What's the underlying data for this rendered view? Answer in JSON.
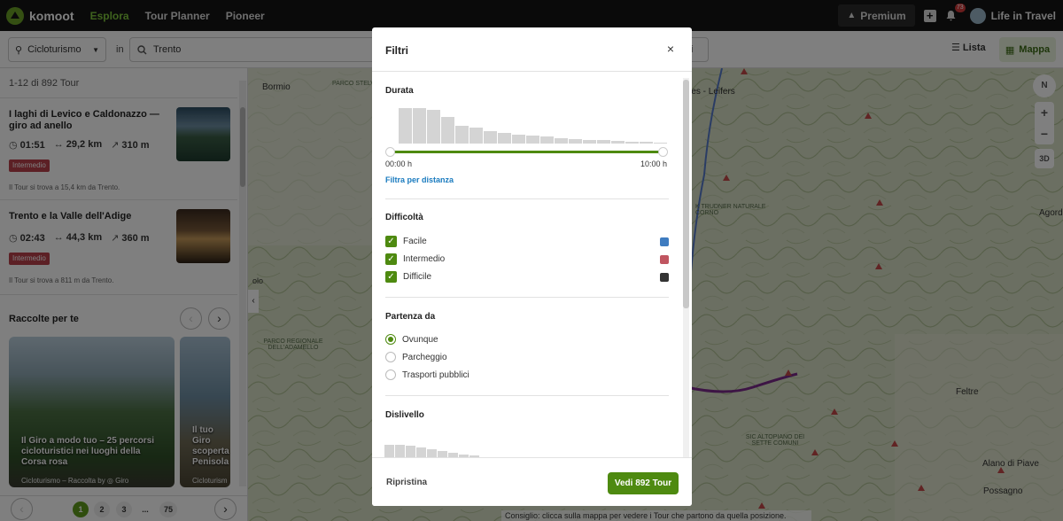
{
  "topbar": {
    "logo": "komoot",
    "nav": [
      "Esplora",
      "Tour Planner",
      "Pioneer"
    ],
    "premium": "Premium",
    "notifications": "73",
    "user": "Life in Travel"
  },
  "filterbar": {
    "sport": "Cicloturismo",
    "in_label": "in",
    "location": "Trento",
    "partial_button": "ri",
    "lista": "Lista",
    "mappa": "Mappa"
  },
  "sidebar": {
    "count": "1-12 di 892 Tour",
    "tours": [
      {
        "title": "I laghi di Levico e Caldonazzo — giro ad anello",
        "duration": "01:51",
        "distance": "29,2 km",
        "elevation": "310 m",
        "difficulty": "Intermedio",
        "note": "Il Tour si trova a 15,4 km da Trento."
      },
      {
        "title": "Trento e la Valle dell'Adige",
        "duration": "02:43",
        "distance": "44,3 km",
        "elevation": "360 m",
        "difficulty": "Intermedio",
        "note": "Il Tour si trova a 811 m da Trento."
      }
    ],
    "collections_title": "Raccolte per te",
    "collections": [
      {
        "title": "Il Giro a modo tuo – 25 percorsi cicloturistici nei luoghi della Corsa rosa",
        "footer": "Cicloturismo – Raccolta by ◎ Giro"
      },
      {
        "title": "Il tuo Giro scoperta Penisola",
        "footer": "Cicloturism"
      }
    ],
    "pages": [
      "1",
      "2",
      "3",
      "...",
      "75"
    ]
  },
  "map": {
    "hint": "Consiglio: clicca sulla mappa per vedere i Tour che partono da quella posizione.",
    "labels": [
      "Bormio",
      "PARCO REGIONALE DELL'ADAMELLO",
      "SIC ALTOPIANO DEI SETTE COMUNI",
      "Laives - Leifers",
      "Feltre",
      "Alano di Piave",
      "Possagno",
      "Agord",
      "olo",
      "PARCO STELVIO",
      "K TRUDNER NATURALE CORNO"
    ],
    "compass": "N",
    "zoom_in": "+",
    "zoom_out": "−",
    "mode_3d": "3D"
  },
  "modal": {
    "title": "Filtri",
    "close": "×",
    "duration": {
      "title": "Durata",
      "min_label": "00:00 h",
      "max_label": "10:00 h",
      "link": "Filtra per distanza",
      "histogram": [
        40,
        40,
        38,
        30,
        20,
        18,
        14,
        12,
        10,
        9,
        8,
        6,
        5,
        4,
        4,
        3,
        2,
        2,
        1
      ]
    },
    "difficulty": {
      "title": "Difficoltà",
      "options": [
        {
          "label": "Facile",
          "checked": true,
          "color": "#3f7cc0"
        },
        {
          "label": "Intermedio",
          "checked": true,
          "color": "#c05560"
        },
        {
          "label": "Difficile",
          "checked": true,
          "color": "#333333"
        }
      ]
    },
    "start": {
      "title": "Partenza da",
      "options": [
        {
          "label": "Ovunque",
          "selected": true
        },
        {
          "label": "Parcheggio",
          "selected": false
        },
        {
          "label": "Trasporti pubblici",
          "selected": false
        }
      ]
    },
    "elevation": {
      "title": "Dislivello",
      "histogram": [
        14,
        14,
        13,
        11,
        9,
        7,
        5,
        3,
        2
      ]
    },
    "reset": "Ripristina",
    "apply": "Vedi 892 Tour"
  },
  "colors": {
    "accent": "#4e8a10",
    "brand": "#6aa127",
    "link": "#1a7bbf",
    "difficulty_badge": "#b8404a"
  }
}
